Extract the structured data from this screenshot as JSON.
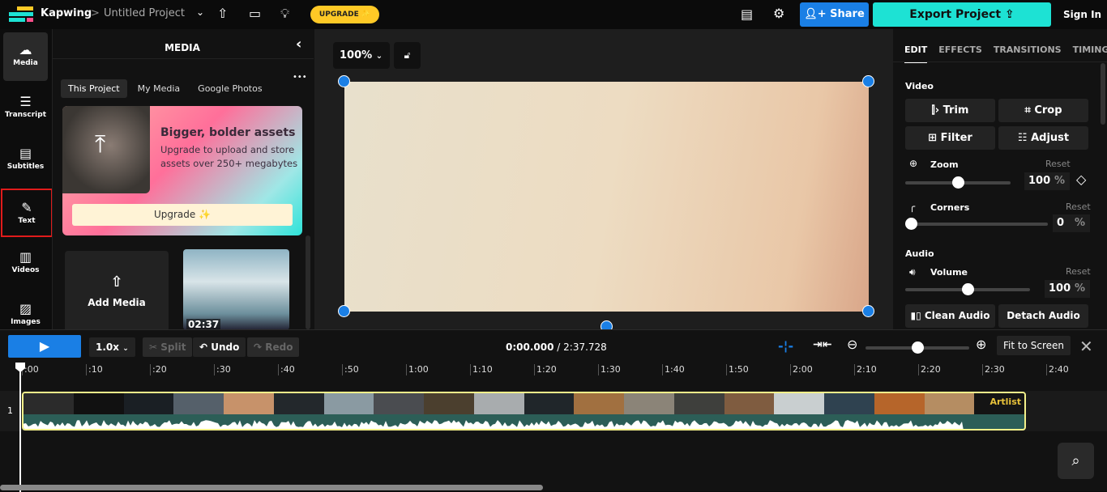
{
  "topbar": {
    "brand": "Kapwing",
    "separator": ">",
    "project": "Untitled Project",
    "upgrade": "UPGRADE ✨",
    "share": "Share",
    "export": "Export Project",
    "signin": "Sign In"
  },
  "rail": [
    {
      "label": "Media",
      "icon": "☁"
    },
    {
      "label": "Transcript",
      "icon": "☰"
    },
    {
      "label": "Subtitles",
      "icon": "▤"
    },
    {
      "label": "Text",
      "icon": "✎"
    },
    {
      "label": "Videos",
      "icon": "▥"
    },
    {
      "label": "Images",
      "icon": "▨"
    }
  ],
  "panel": {
    "title": "MEDIA",
    "tabs": [
      "This Project",
      "My Media",
      "Google Photos"
    ],
    "more": "•••",
    "promo_title": "Bigger, bolder assets",
    "promo_text": "Upgrade to upload and store assets over 250+ megabytes",
    "promo_button": "Upgrade ✨",
    "add_media": "Add Media",
    "clip_duration": "02:37"
  },
  "stage": {
    "zoom": "100%"
  },
  "right": {
    "tabs": [
      "EDIT",
      "EFFECTS",
      "TRANSITIONS",
      "TIMING"
    ],
    "video": "Video",
    "trim": "Trim",
    "crop": "Crop",
    "filter": "Filter",
    "adjust": "Adjust",
    "zoom": "Zoom",
    "reset": "Reset",
    "zoom_value": "100",
    "pct": "%",
    "corners": "Corners",
    "corners_value": "0",
    "audio": "Audio",
    "volume": "Volume",
    "volume_value": "100",
    "clean_audio": "Clean Audio ✨",
    "detach_audio": "Detach Audio",
    "zoom_level": 0.5,
    "corners_level": 0,
    "volume_level": 0.5
  },
  "timeline": {
    "speed": "1.0x",
    "split": "Split",
    "undo": "Undo",
    "redo": "Redo",
    "time": "0:00.000",
    "duration": "/ 2:37.728",
    "fit": "Fit to Screen",
    "track": "1",
    "zoom_level": 0.5,
    "ticks": [
      ":00",
      ":10",
      ":20",
      ":30",
      ":40",
      ":50",
      "1:00",
      "1:10",
      "1:20",
      "1:30",
      "1:40",
      "1:50",
      "2:00",
      "2:10",
      "2:20",
      "2:30",
      "2:40"
    ],
    "thumb_colors": [
      "#2b2b2b",
      "#111111",
      "#1a1f24",
      "#55606a",
      "#c7926a",
      "#23282c",
      "#8a9aa2",
      "#4a4c50",
      "#4b3f2e",
      "#a8acae",
      "#20262a",
      "#a17040",
      "#8b8478",
      "#3e3f3c",
      "#7f5c40",
      "#c9cfd0",
      "#2f4250",
      "#b6652a",
      "#b58d62",
      "#141414"
    ],
    "end_label": "Artlist"
  }
}
